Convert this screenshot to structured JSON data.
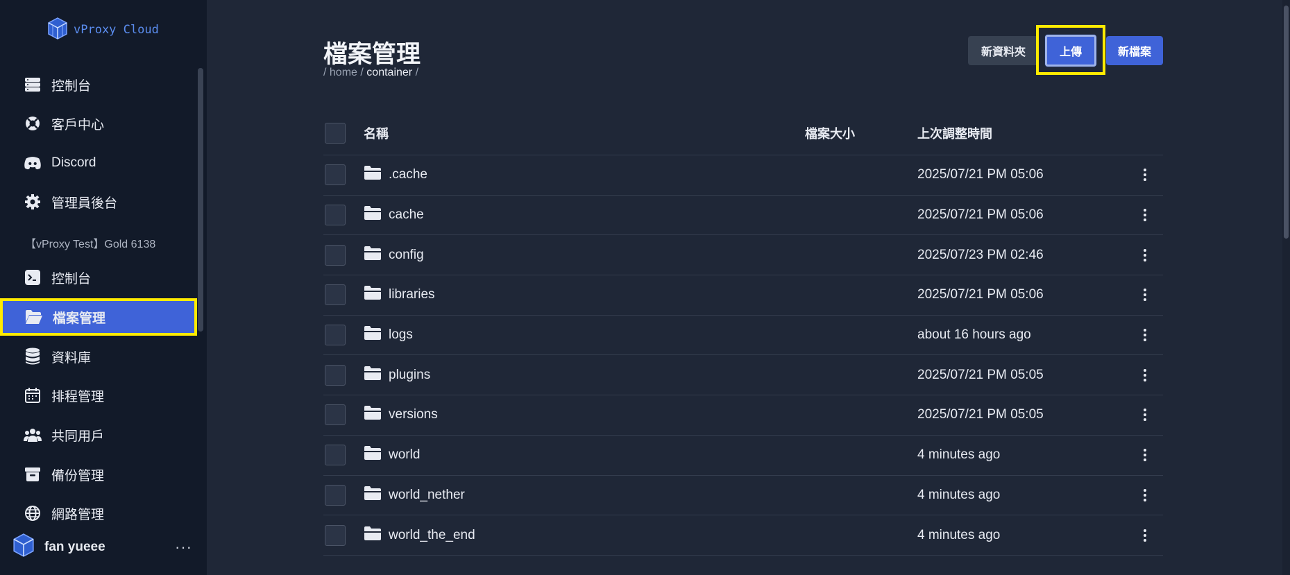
{
  "app": {
    "name": "vProxy Cloud"
  },
  "sidebar": {
    "items_top": [
      {
        "label": "控制台",
        "icon": "server-stack-icon"
      },
      {
        "label": "客戶中心",
        "icon": "lifebuoy-icon"
      },
      {
        "label": "Discord",
        "icon": "discord-icon"
      },
      {
        "label": "管理員後台",
        "icon": "gear-icon"
      }
    ],
    "server_label": "【vProxy Test】Gold 6138",
    "items_server": [
      {
        "label": "控制台",
        "icon": "terminal-icon"
      },
      {
        "label": "檔案管理",
        "icon": "folder-open-icon",
        "active": true
      },
      {
        "label": "資料庫",
        "icon": "database-icon"
      },
      {
        "label": "排程管理",
        "icon": "calendar-icon"
      },
      {
        "label": "共同用戶",
        "icon": "users-icon"
      },
      {
        "label": "備份管理",
        "icon": "archive-box-icon"
      },
      {
        "label": "網路管理",
        "icon": "globe-icon"
      }
    ],
    "user": {
      "name": "fan yueee",
      "more": "···"
    }
  },
  "page": {
    "title": "檔案管理",
    "breadcrumb": {
      "sep1": "/",
      "home": "home",
      "sep2": "/",
      "current": "container",
      "sep3": "/"
    }
  },
  "actions": {
    "new_folder": "新資料夾",
    "upload": "上傳",
    "new_file": "新檔案"
  },
  "table": {
    "headers": {
      "name": "名稱",
      "size": "檔案大小",
      "modified": "上次調整時間"
    },
    "rows": [
      {
        "name": ".cache",
        "size": "",
        "modified": "2025/07/21 PM 05:06"
      },
      {
        "name": "cache",
        "size": "",
        "modified": "2025/07/21 PM 05:06"
      },
      {
        "name": "config",
        "size": "",
        "modified": "2025/07/23 PM 02:46"
      },
      {
        "name": "libraries",
        "size": "",
        "modified": "2025/07/21 PM 05:06"
      },
      {
        "name": "logs",
        "size": "",
        "modified": "about 16 hours ago"
      },
      {
        "name": "plugins",
        "size": "",
        "modified": "2025/07/21 PM 05:05"
      },
      {
        "name": "versions",
        "size": "",
        "modified": "2025/07/21 PM 05:05"
      },
      {
        "name": "world",
        "size": "",
        "modified": "4 minutes ago"
      },
      {
        "name": "world_nether",
        "size": "",
        "modified": "4 minutes ago"
      },
      {
        "name": "world_the_end",
        "size": "",
        "modified": "4 minutes ago"
      }
    ]
  },
  "colors": {
    "accent": "#3f63d8",
    "highlight": "#ffeb00",
    "bg": "#1f2737",
    "sidebar_bg": "#121a29"
  }
}
